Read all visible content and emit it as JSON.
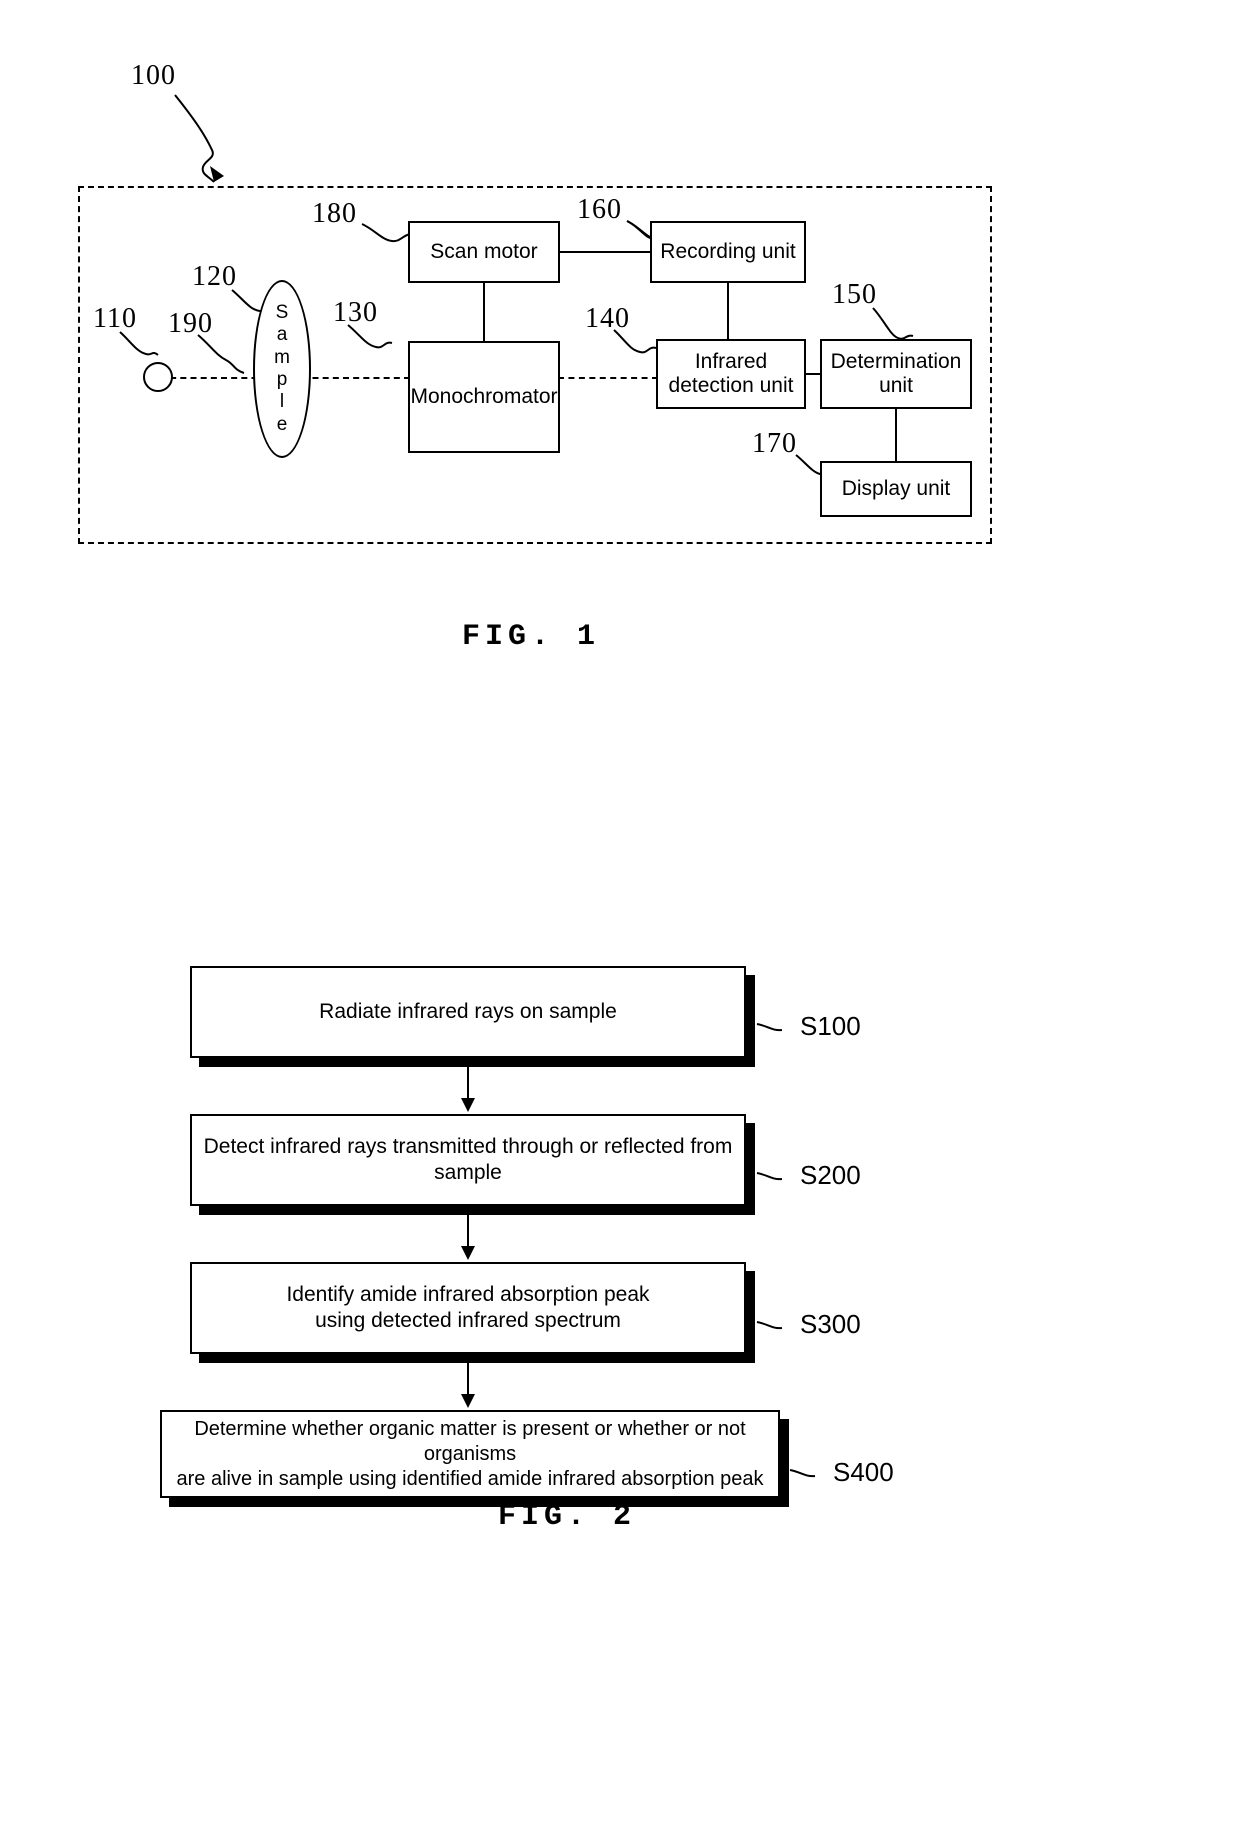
{
  "figure1": {
    "caption": "FIG. 1",
    "system_ref": "100",
    "components": [
      {
        "ref": "110",
        "label": "",
        "name": "light-source"
      },
      {
        "ref": "120",
        "label": "Sample",
        "name": "sample"
      },
      {
        "ref": "130",
        "label": "Monochromator",
        "name": "monochromator"
      },
      {
        "ref": "140",
        "label": "Infrared\ndetection unit",
        "name": "infrared-detection-unit"
      },
      {
        "ref": "150",
        "label": "Determination\nunit",
        "name": "determination-unit"
      },
      {
        "ref": "160",
        "label": "Recording unit",
        "name": "recording-unit"
      },
      {
        "ref": "170",
        "label": "Display unit",
        "name": "display-unit"
      },
      {
        "ref": "180",
        "label": "Scan motor",
        "name": "scan-motor"
      },
      {
        "ref": "190",
        "label": "",
        "name": "infrared-beam-path"
      }
    ],
    "box_labels": {
      "scan_motor": "Scan motor",
      "recording_unit": "Recording unit",
      "monochromator": "Monochromator",
      "infrared_detection_unit": "Infrared\ndetection unit",
      "determination_unit": "Determination\nunit",
      "display_unit": "Display unit",
      "sample": "S\na\nm\np\nl\ne"
    },
    "refs": {
      "r100": "100",
      "r110": "110",
      "r120": "120",
      "r130": "130",
      "r140": "140",
      "r150": "150",
      "r160": "160",
      "r170": "170",
      "r180": "180",
      "r190": "190"
    }
  },
  "figure2": {
    "caption": "FIG. 2",
    "steps": [
      {
        "id": "S100",
        "text": "Radiate infrared rays on sample"
      },
      {
        "id": "S200",
        "text": "Detect infrared rays transmitted through or reflected from sample"
      },
      {
        "id": "S300",
        "text": "Identify amide infrared absorption peak\nusing detected infrared spectrum"
      },
      {
        "id": "S400",
        "text": "Determine whether organic matter is present or whether or not organisms\nare alive in sample using identified amide infrared absorption peak"
      }
    ],
    "step_ids": {
      "s100": "S100",
      "s200": "S200",
      "s300": "S300",
      "s400": "S400"
    },
    "step_texts": {
      "s100": "Radiate infrared rays on sample",
      "s200": "Detect infrared rays transmitted through or reflected from sample",
      "s300": "Identify amide infrared absorption peak\nusing detected infrared spectrum",
      "s400": "Determine whether organic matter is present or whether or not organisms\nare alive in sample using identified amide infrared absorption peak"
    }
  },
  "colors": {
    "line": "#000000",
    "background": "#ffffff"
  }
}
